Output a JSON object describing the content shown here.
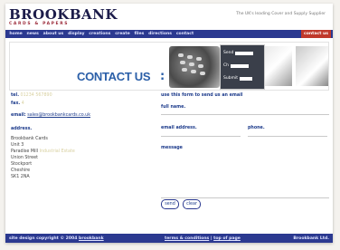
{
  "header": {
    "logo": "BROOKBANK",
    "logo_sub": "CARDS & PAPERS",
    "tagline": "The UK's leading Cover and Supply Supplier"
  },
  "nav": {
    "items": [
      "home",
      "news",
      "about us",
      "display",
      "creations",
      "create",
      "files",
      "directions",
      "contact"
    ],
    "active": "contact us"
  },
  "banner": {
    "title": "CONTACT US",
    "colon": ":",
    "card_rows": [
      "Send",
      "Ch",
      "Submit"
    ]
  },
  "contact": {
    "tel_label": "tel.",
    "tel_value": "01234 567890",
    "fax_label": "fax.",
    "fax_value": "4",
    "email_label": "email:",
    "email_value": "sales@brookbankcards.co.uk",
    "address_label": "address.",
    "address_lines": [
      {
        "text": "Brookbank Cards",
        "fade": ""
      },
      {
        "text": "Unit 3",
        "fade": ""
      },
      {
        "text": "Paradise Mill",
        "fade": "Industrial Estate"
      },
      {
        "text": "Union Street",
        "fade": ""
      },
      {
        "text": "Stockport",
        "fade": ""
      },
      {
        "text": "Cheshire",
        "fade": ""
      },
      {
        "text": "SK1 2NA",
        "fade": ""
      }
    ]
  },
  "form": {
    "title": "use this form to send us an email",
    "full_name_label": "full name.",
    "email_label": "email address.",
    "phone_label": "phone.",
    "message_label": "message",
    "send_label": "send",
    "clear_label": "clear"
  },
  "footer": {
    "left": "site design copyright © 2004",
    "left_link": "brookbank",
    "mid_terms": "terms & conditions",
    "mid_sep": " | ",
    "mid_top": "top of page",
    "right": "Brookbank Ltd."
  },
  "colors": {
    "nav_bg": "#2b3990",
    "active_tab": "#c0392b",
    "title_blue": "#2b5fa8"
  }
}
